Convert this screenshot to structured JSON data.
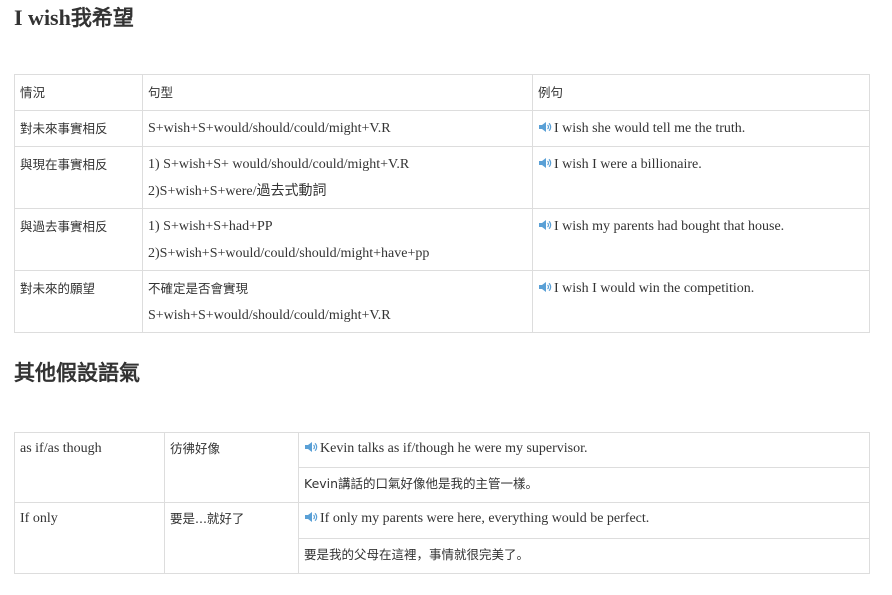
{
  "section1": {
    "heading_en": "I wish",
    "heading_zh": "我希望",
    "columns": [
      "情況",
      "句型",
      "例句"
    ],
    "rows": [
      {
        "situation": "對未來事實相反",
        "patterns": [
          "S+wish+S+would/should/could/might+V.R"
        ],
        "example": "I wish she would tell me the truth."
      },
      {
        "situation": "與現在事實相反",
        "patterns": [
          "1) S+wish+S+ would/should/could/might+V.R",
          "2)S+wish+S+were/過去式動詞"
        ],
        "example": "I wish I were a billionaire."
      },
      {
        "situation": "與過去事實相反",
        "patterns": [
          "1) S+wish+S+had+PP",
          "2)S+wish+S+would/could/should/might+have+pp"
        ],
        "example": "I wish my parents had bought that house."
      },
      {
        "situation": "對未來的願望",
        "patterns": [
          "不確定是否會實現",
          "S+wish+S+would/should/could/might+V.R"
        ],
        "example": "I wish I would win the competition."
      }
    ]
  },
  "section2": {
    "heading": "其他假設語氣",
    "rows": [
      {
        "phrase": "as if/as though",
        "meaning": "彷彿好像",
        "example": "Kevin talks as if/though he were my supervisor.",
        "translation": "Kevin講話的口氣好像他是我的主管一樣。"
      },
      {
        "phrase": "If only",
        "meaning": "要是...就好了",
        "example": "If only my parents were here, everything would be perfect.",
        "translation": "要是我的父母在這裡，事情就很完美了。"
      }
    ]
  },
  "colors": {
    "text": "#333333",
    "border": "#dddddd",
    "speaker": "#5aa0d6"
  },
  "icons": {
    "audio": "speaker-icon"
  }
}
